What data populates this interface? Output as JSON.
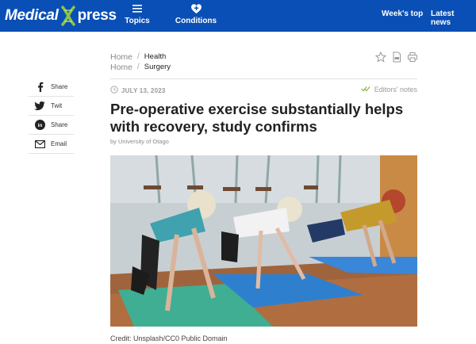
{
  "header": {
    "logo_left": "Medical",
    "logo_right": "press",
    "nav": [
      {
        "label": "Topics",
        "icon": "menu-icon"
      },
      {
        "label": "Conditions",
        "icon": "heart-plus-icon"
      }
    ],
    "right_links": [
      "Week's top",
      "Latest news"
    ],
    "colors": {
      "bar": "#0a4fb5",
      "logo_x": "#8cc63f"
    }
  },
  "breadcrumb": [
    {
      "link": "Home",
      "current": "Health"
    },
    {
      "link": "Home",
      "current": "Surgery"
    }
  ],
  "tools": [
    "bookmark-star-icon",
    "pdf-icon",
    "print-icon"
  ],
  "article": {
    "date": "JULY 13, 2023",
    "editors_note": "Editors' notes",
    "title": "Pre-operative exercise substantially helps with recovery, study confirms",
    "by": "by",
    "source": "University of Otago",
    "image_credit": "Credit: Unsplash/CC0 Public Domain"
  },
  "share": [
    {
      "label": "Share",
      "icon": "facebook-icon"
    },
    {
      "label": "Twit",
      "icon": "twitter-icon"
    },
    {
      "label": "Share",
      "icon": "linkedin-icon"
    },
    {
      "label": "Email",
      "icon": "email-icon"
    }
  ]
}
